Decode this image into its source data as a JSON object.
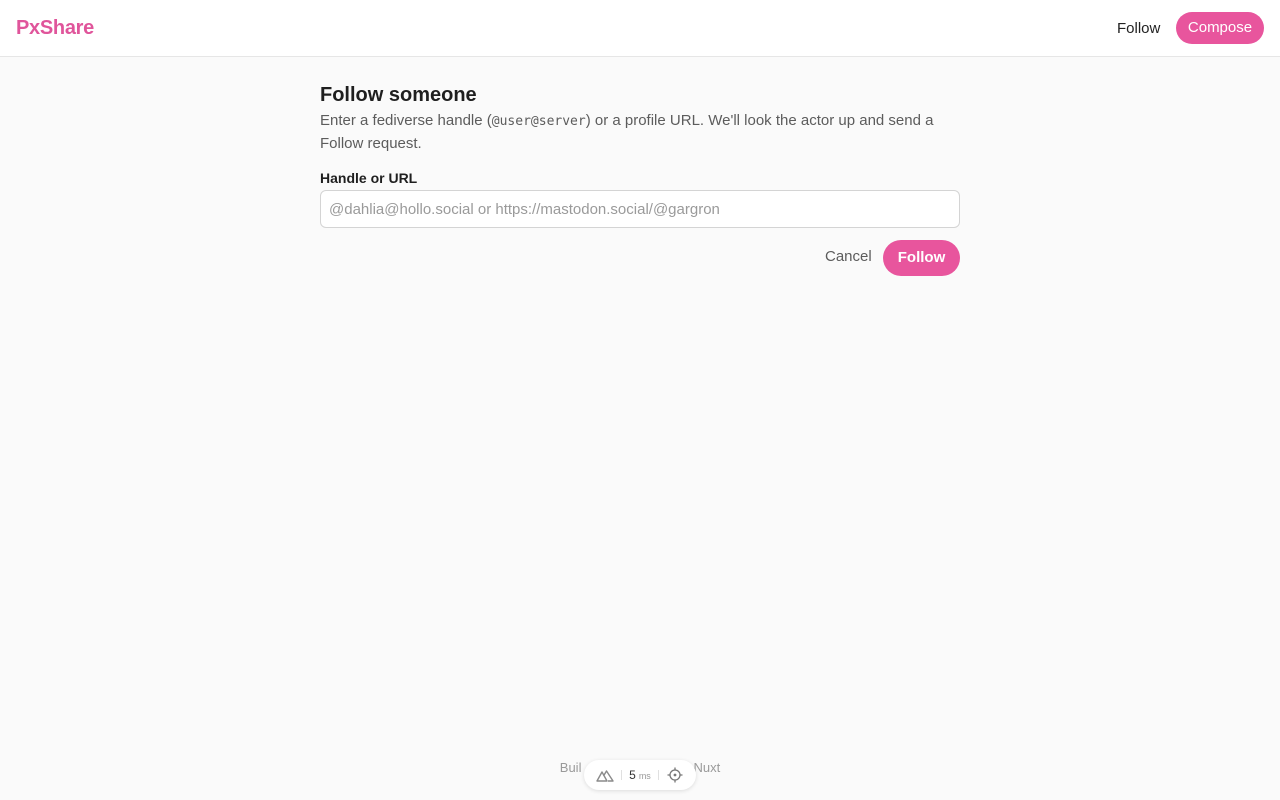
{
  "header": {
    "logo": "PxShare",
    "nav_follow": "Follow",
    "compose": "Compose"
  },
  "form": {
    "title": "Follow someone",
    "desc_before": "Enter a fediverse handle (",
    "desc_code": "@user@server",
    "desc_after": ") or a profile URL. We'll look the actor up and send a Follow request.",
    "label": "Handle or URL",
    "placeholder": "@dahlia@hollo.social or https://mastodon.social/@gargron",
    "value": "",
    "cancel": "Cancel",
    "submit": "Follow"
  },
  "footer": {
    "text_left": "Buil",
    "text_right": "Nuxt"
  },
  "devtools": {
    "time": "5",
    "unit": "ms",
    "icons": [
      "nuxt-logo-icon",
      "crosshair-icon"
    ]
  },
  "colors": {
    "accent": "#e8559d",
    "background": "#fafafa"
  }
}
